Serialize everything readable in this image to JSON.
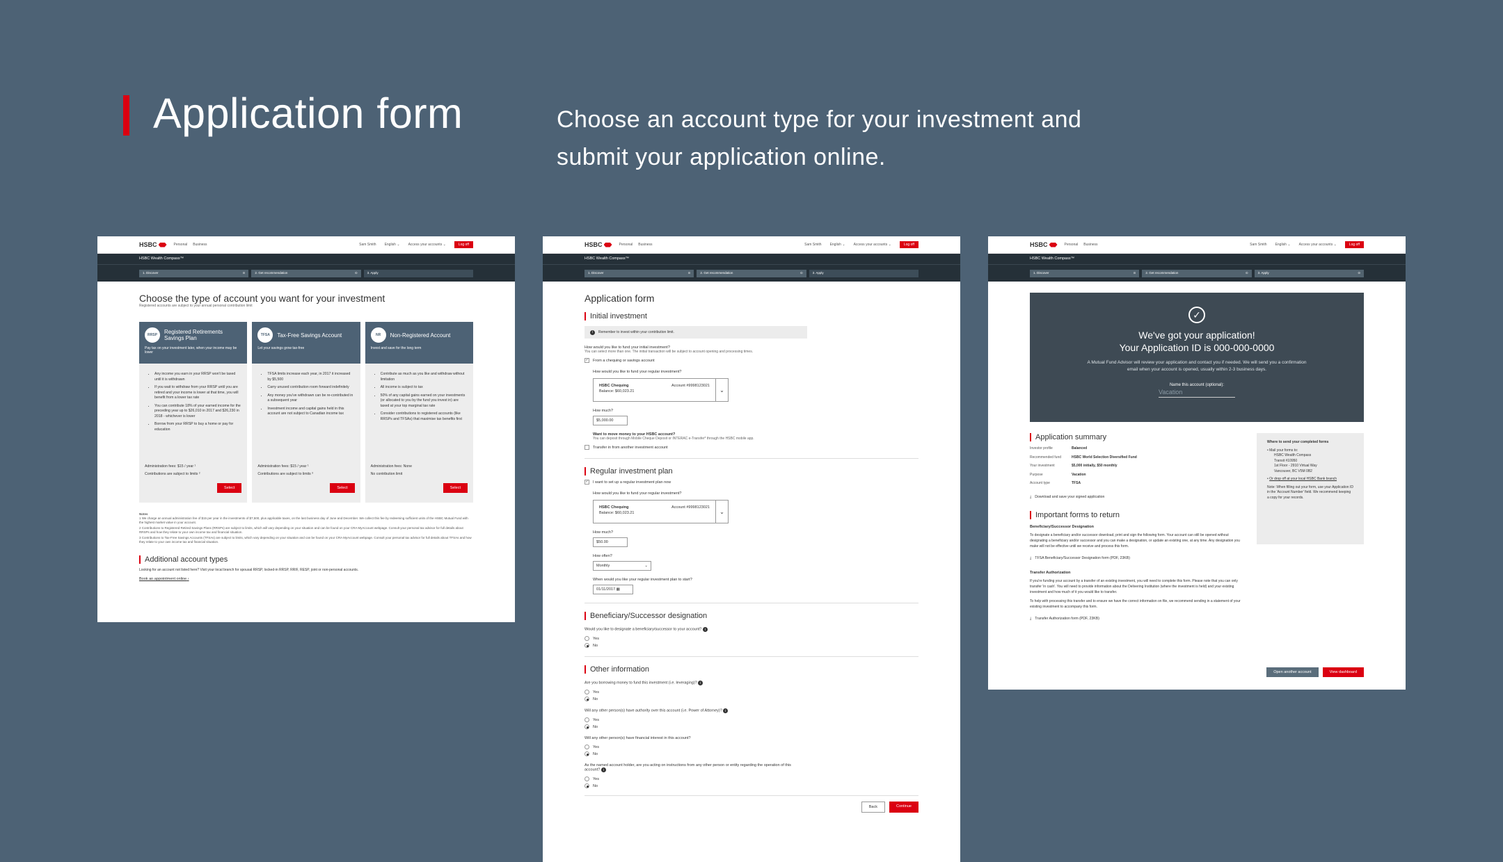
{
  "hero": {
    "title": "Application form",
    "subtitle": "Choose an account type for your investment and submit your application online."
  },
  "topbar": {
    "logo": "HSBC",
    "nav_personal": "Personal",
    "nav_business": "Business",
    "user": "Sam Smith",
    "language": "English",
    "accounts": "Access your accounts",
    "logout": "Log off"
  },
  "product_name": "HSBC Wealth Compass™",
  "steps": [
    "1. Discover",
    "2. Get recommendation",
    "3. Apply"
  ],
  "screen1": {
    "title": "Choose the type of account you want for your investment",
    "subtitle": "Registered accounts are subject to your annual personal contribution limit",
    "cards": [
      {
        "badge": "RRSP",
        "name": "Registered Retirements Savings Plan",
        "desc": "Pay tax on your investment later, when your income may be lower",
        "bullets": [
          "Any income you earn in your RRSP won't be taxed until it is withdrawn",
          "If you wait to withdraw from your RRSP until you are retired and your income is lower at that time, you will benefit from a lower tax rate",
          "You can contribute 18% of your earned income for the preceding year up to $26,010 in 2017 and $26,230 in 2018 - whichever is lower",
          "Borrow from your RRSP to buy a home or pay for education"
        ],
        "fee": "Administration fees: $15 / year ¹",
        "limit": "Contributions are subject to limits ²",
        "button": "Select"
      },
      {
        "badge": "TFSA",
        "name": "Tax-Free Savings Account",
        "desc": "Let your savings grow tax-free",
        "bullets": [
          "TFSA limits increase each year, in 2017 it increased by $5,500",
          "Carry unused contribution room forward indefinitely",
          "Any money you've withdrawn can be re-contributed in a subsequent year",
          "Investment income and capital gains held in this account are not subject to Canadian income tax"
        ],
        "fee": "Administration fees: $15 / year ¹",
        "limit": "Contributions are subject to limits ³",
        "button": "Select"
      },
      {
        "badge": "NR",
        "name": "Non-Registered Account",
        "desc": "Invest and save for the long term",
        "bullets": [
          "Contribute as much as you like and withdraw without limitation",
          "All income is subject to tax",
          "50% of any capital gains earned on your investments (or allocated to you by the fund you invest in) are taxed at your top marginal tax rate",
          "Consider contributions to registered accounts (like RRSPs and TFSAs) that maximise tax benefits first"
        ],
        "fee": "Administration fees: None",
        "limit": "No contribution limit",
        "button": "Select"
      }
    ],
    "notes_title": "Notes",
    "notes": [
      "1 We charge an annual administration fee of $15 per year in the investments of $7,500, plus applicable taxes, on the last business day of June and December. We collect this fee by redeeming sufficient units of the HSBC Mutual Fund with the highest market value in your account.",
      "2 Contributions to Registered Retired Savings Plans (RRSPs) are subject to limits, which will vary depending on your situation and can be found on your CRA MyAccount webpage. Consult your personal tax advisor for full details about RRSPs and how they relate to your own income tax and financial situation.",
      "3 Contributions to Tax-Free Savings Accounts (TFSAs) are subject to limits, which vary depending on your situation and can be found on your CRA MyAccount webpage. Consult your personal tax advisor for full details about TFSAs and how they relate to your own income tax and financial situation."
    ],
    "additional_title": "Additional account types",
    "additional_text": "Looking for an account not listed here? Visit your local branch for spousal RRSP, locked-in RRSP, RRIF, RESP, joint or non-personal accounts.",
    "appointment_link": "Book an appointment online"
  },
  "screen2": {
    "title": "Application form",
    "initial_title": "Initial investment",
    "info": "Remember to invest within your contribution limit.",
    "q_fund_initial": "How would you like to fund your initial investment?",
    "q_fund_initial_sub": "You can select more than one. The initial transaction will be subject to account opening and processing times.",
    "opt_chequing": "From a chequing or savings account",
    "q_fund_regular": "How would you like to fund your regular investment?",
    "acct_name": "HSBC Chequing",
    "acct_number": "Account #9998123021",
    "acct_balance": "Balance: $60,023.21",
    "how_much": "How much?",
    "amount_initial": "$5,000.00",
    "more_money": "Want to move money to your HSBC account?",
    "more_money_sub": "You can deposit through Mobile Cheque Deposit or INTERAC e-Transfer* through the HSBC mobile app.",
    "opt_transfer": "Transfer in from another investment account",
    "regular_title": "Regular investment plan",
    "opt_regular": "I want to set up a regular investment plan now",
    "amount_regular": "$50.00",
    "how_often": "How often?",
    "frequency": "Monthly",
    "q_start": "When would you like your regular investment plan to start?",
    "start_date": "01/11/2017",
    "beneficiary_title": "Beneficiary/Successor designation",
    "q_beneficiary": "Would you like to designate a beneficiary/successor to your account?",
    "yes": "Yes",
    "no": "No",
    "other_title": "Other information",
    "q_leverage": "Are you borrowing money to fund this investment (i.e. leveraging)?",
    "q_poa": "Will any other person(s) have authority over this account (i.e. Power of Attorney)?",
    "q_interest": "Will any other person(s) have financial interest in this account?",
    "q_instructions": "As the named account holder, are you acting on instructions from any other person or entity regarding the operation of this account?",
    "back": "Back",
    "continue": "Continue"
  },
  "screen3": {
    "confirm_line1": "We've got your application!",
    "confirm_line2": "Your Application ID is 000-000-0000",
    "confirm_text": "A Mutual Fund Advisor will review your application and contact you if needed. We will send you a confirmation email when your account is opened, usually within 2-3 business days.",
    "name_label": "Name this account (optional):",
    "name_placeholder": "Vacation",
    "summary_title": "Application summary",
    "summary": [
      {
        "k": "Investor profile",
        "v": "Balanced"
      },
      {
        "k": "Recommended fund",
        "v": "HSBC World Selection Diversified Fund"
      },
      {
        "k": "Your investment",
        "v": "$5,000 initially, $50 monthly"
      },
      {
        "k": "Purpose",
        "v": "Vacation"
      },
      {
        "k": "Account type",
        "v": "TFSA"
      }
    ],
    "download": "Download and save your signed application",
    "forms_title": "Important forms to return",
    "bene_h": "Beneficiary/Successor Designation",
    "bene_text": "To designate a beneficiary and/or successor download, print and sign the following form. Your account can still be opened without designating a beneficiary and/or successor and you can make a designation, or update an existing one, at any time. Any designation you make will not be effective until we receive and process this form.",
    "bene_form": "TFSA Beneficiary/Successor Designation form (PDF, 23KB)",
    "transfer_h": "Transfer Authorization",
    "transfer_text": "If you're funding your account by a transfer of an existing investment, you will need to complete this form. Please note that you can only transfer 'in cash'. You will need to provide information about the Delivering Institution (where the investment is held) and your existing investment and how much of it you would like to transfer.",
    "transfer_text2": "To help with processing this transfer and to ensure we have the correct information on file, we recommend sending in a statement of your existing investment to accompany this form.",
    "transfer_form": "Transfer Authorization form (PDF, 23KB)",
    "where_title": "Where to send your completed forms",
    "mail_intro": "Mail your forms to:",
    "address": [
      "HSBC Wealth Compass",
      "Transit #10950",
      "1st Floor - 2910 Virtual Way",
      "Vancouver, BC V5M 0B2"
    ],
    "dropoff": "Or drop off at your local HSBC Bank branch",
    "note": "Note: When filling out your form, use your Application ID in the 'Account Number' field. We recommend keeping a copy for your records.",
    "open_another": "Open another account",
    "view_dashboard": "View dashboard"
  },
  "colors": {
    "accent": "#db0011",
    "background": "#4d6275",
    "dark": "#253038"
  }
}
